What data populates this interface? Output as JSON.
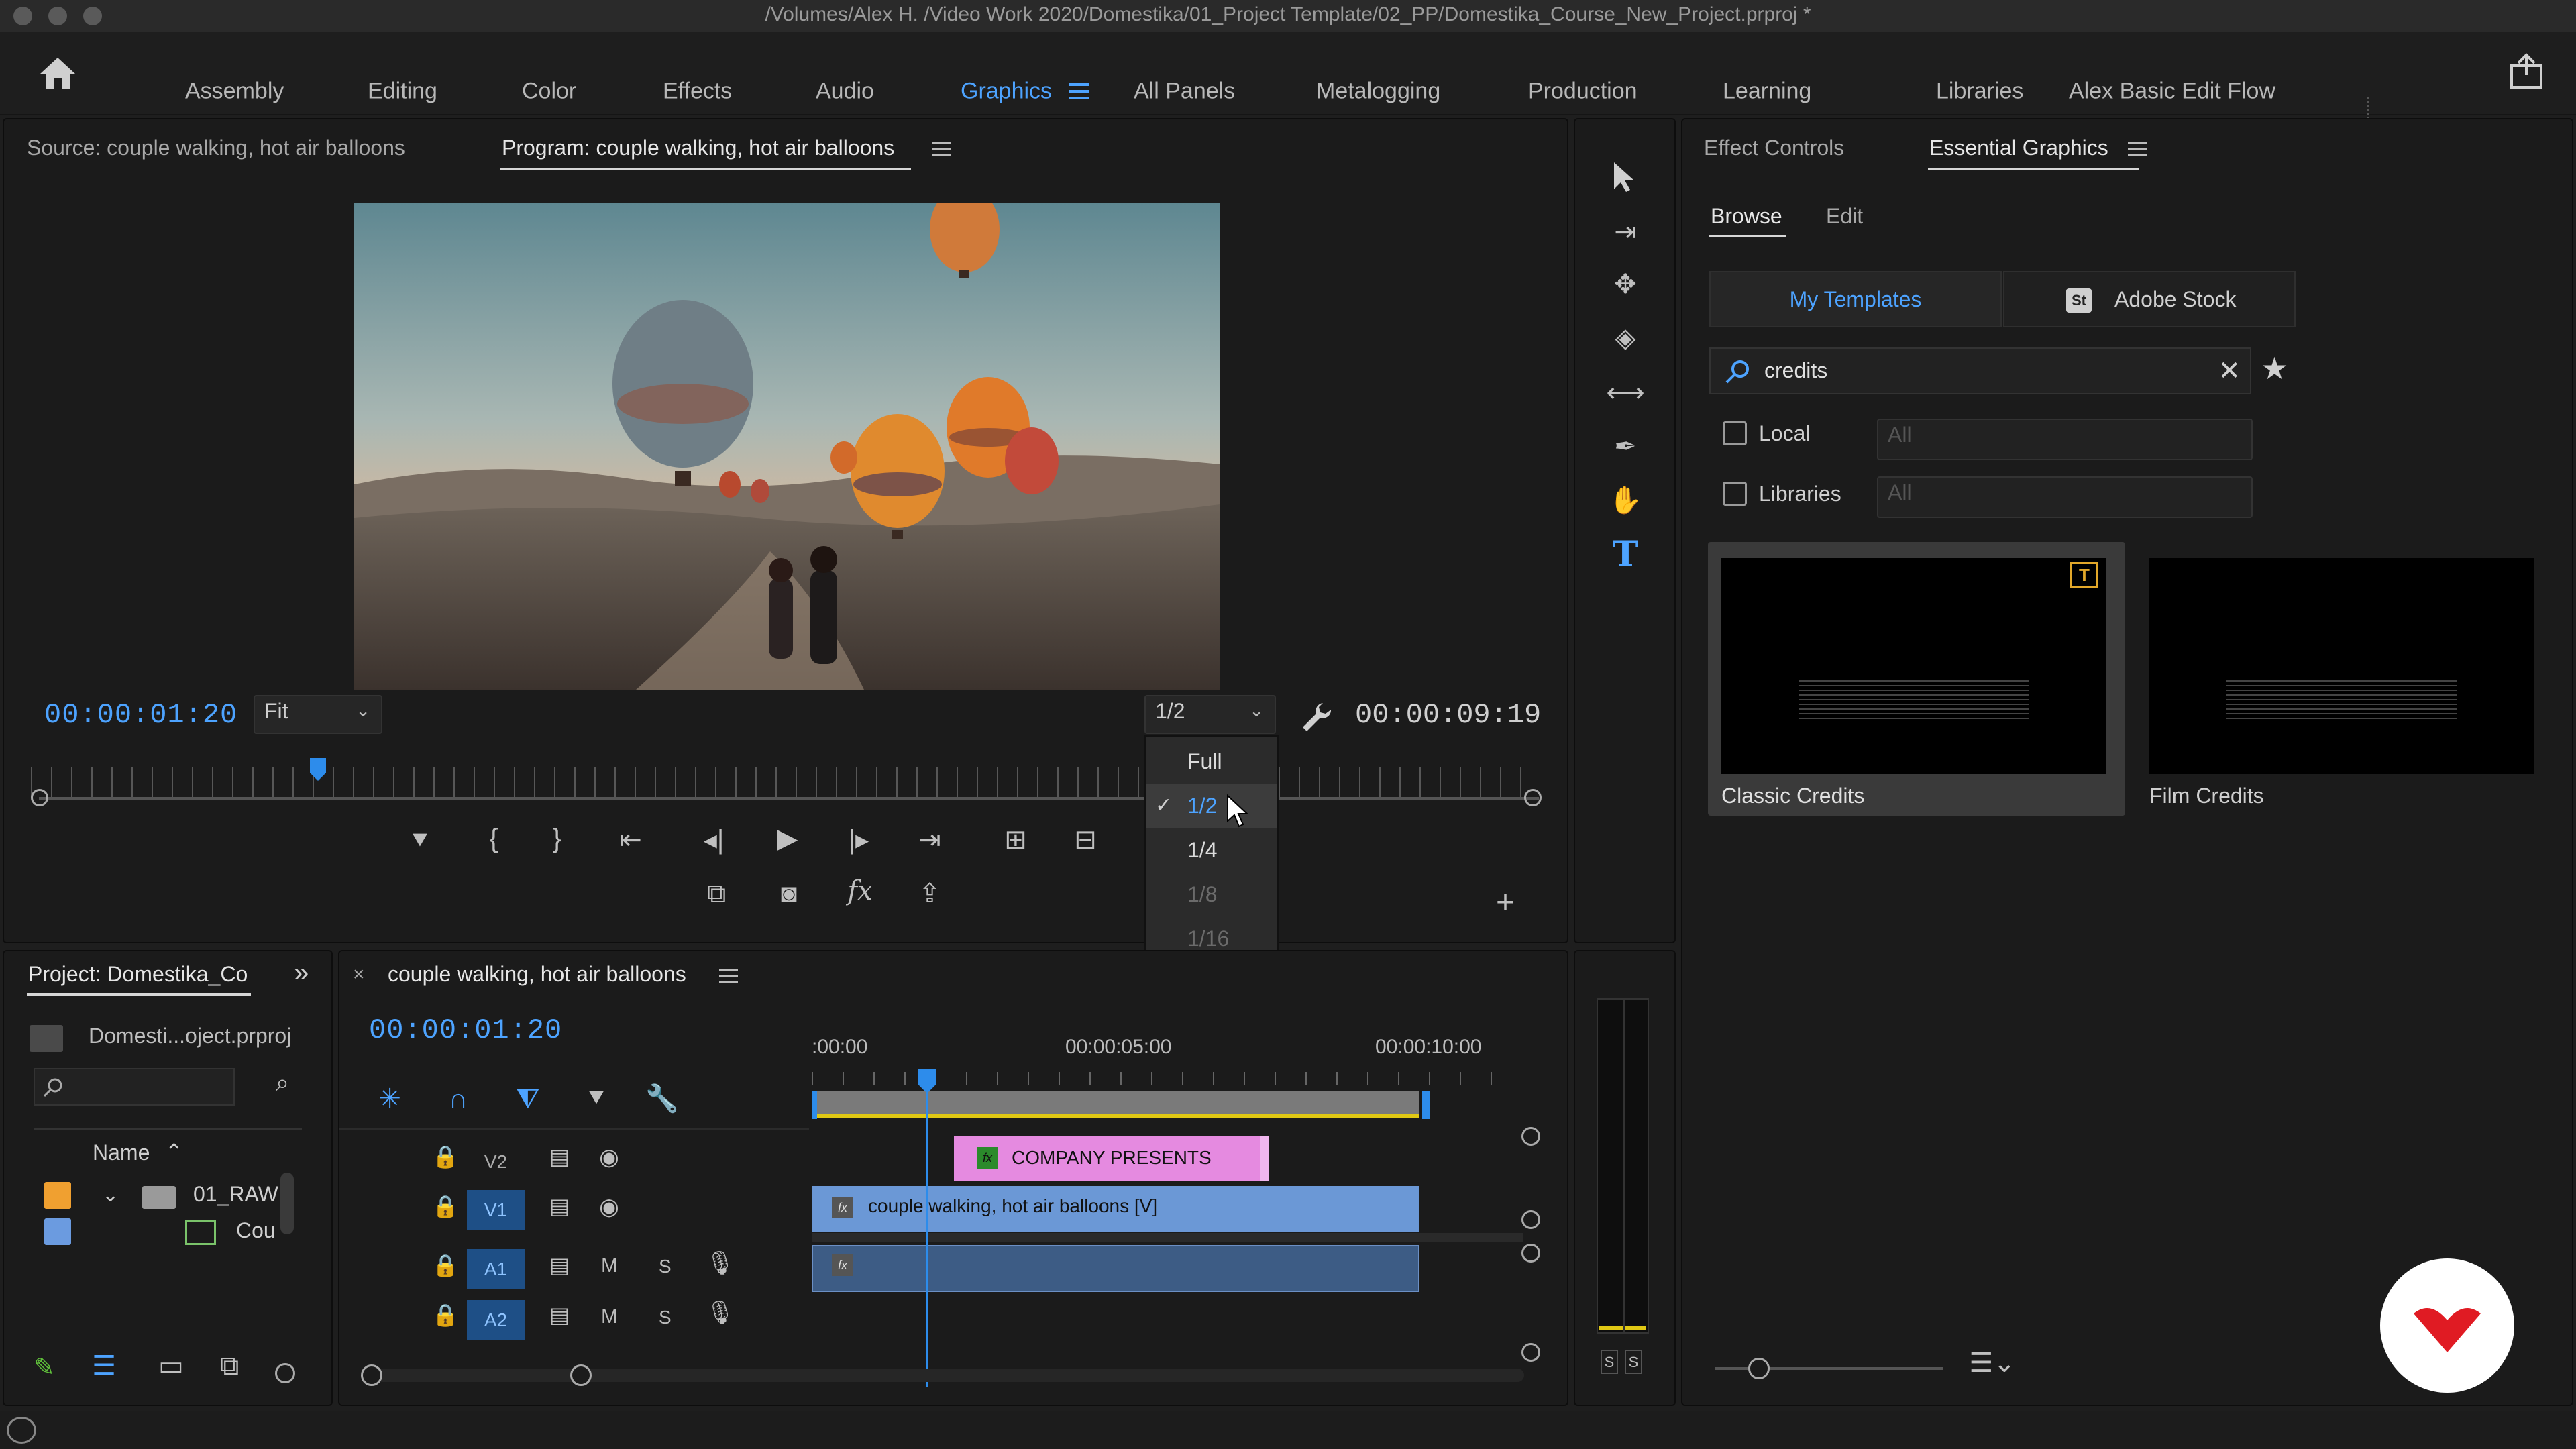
{
  "window": {
    "title": "/Volumes/Alex H. /Video Work 2020/Domestika/01_Project Template/02_PP/Domestika_Course_New_Project.prproj *"
  },
  "workspaces": {
    "items": [
      "Assembly",
      "Editing",
      "Color",
      "Effects",
      "Audio",
      "Graphics",
      "All Panels",
      "Metalogging",
      "Production",
      "Learning",
      "Libraries",
      "Alex Basic Edit Flow"
    ],
    "active": "Graphics"
  },
  "monitor": {
    "source_tab": "Source: couple walking, hot air balloons",
    "program_tab": "Program: couple walking, hot air balloons",
    "current_time": "00:00:01:20",
    "duration": "00:00:09:19",
    "zoom": "Fit",
    "resolution": "1/2",
    "resolution_menu": [
      "Full",
      "1/2",
      "1/4",
      "1/8",
      "1/16"
    ],
    "resolution_selected_index": 1,
    "playhead_fraction": 0.19
  },
  "essential_graphics": {
    "effect_controls_tab": "Effect Controls",
    "tab": "Essential Graphics",
    "browse_tab": "Browse",
    "edit_tab": "Edit",
    "my_templates": "My Templates",
    "adobe_stock": "Adobe Stock",
    "adobe_stock_badge": "St",
    "search_value": "credits",
    "local_label": "Local",
    "libraries_label": "Libraries",
    "local_select": "All",
    "libraries_select": "All",
    "templates": [
      {
        "name": "Classic Credits"
      },
      {
        "name": "Film Credits"
      }
    ]
  },
  "project": {
    "tab": "Project: Domestika_Co",
    "file": "Domesti...oject.prproj",
    "name_header": "Name",
    "items": [
      "01_RAW",
      "Cou"
    ],
    "colors": {
      "folder": "#f0a030",
      "clip": "#6b9be0"
    }
  },
  "timeline": {
    "sequence_tab": "couple walking, hot air balloons",
    "current_time": "00:00:01:20",
    "ruler_labels": [
      ":00:00",
      "00:00:05:00",
      "00:00:10:00"
    ],
    "tracks": [
      "V2",
      "V1",
      "A1",
      "A2"
    ],
    "mute": "M",
    "solo": "S",
    "clips": {
      "title_clip": "COMPANY PRESENTS",
      "video_clip": "couple walking, hot air balloons [V]",
      "fx_badge": "fx"
    },
    "colors": {
      "title_clip": "#e58ae0",
      "video_clip": "#6b98d6",
      "audio_clip": "#3d5c85"
    }
  },
  "meters": {
    "s1": "S",
    "s2": "S"
  }
}
